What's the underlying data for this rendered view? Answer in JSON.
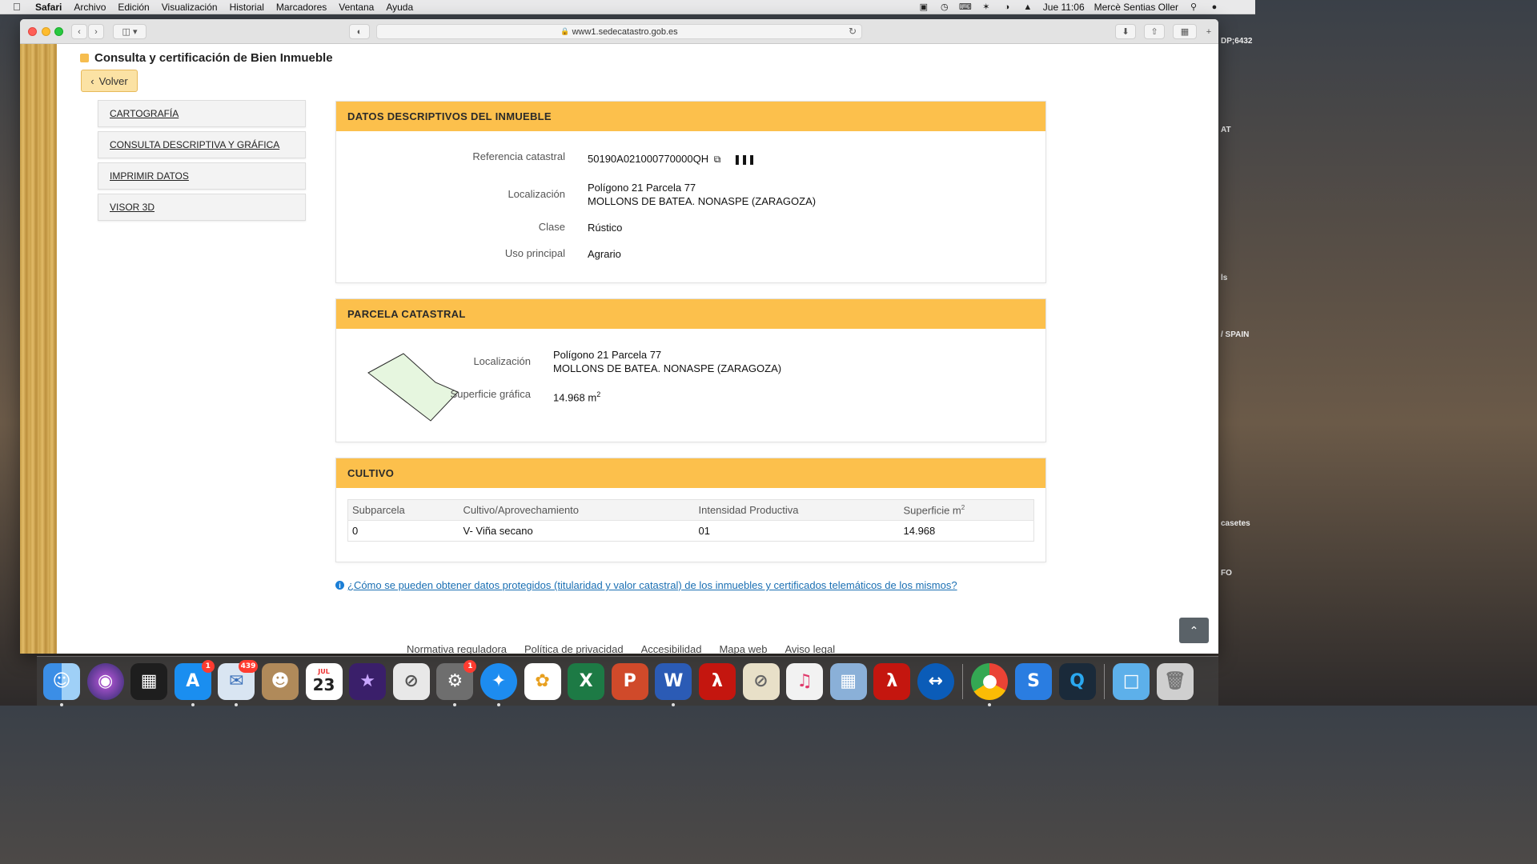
{
  "menubar": {
    "app": "Safari",
    "items": [
      "Archivo",
      "Edición",
      "Visualización",
      "Historial",
      "Marcadores",
      "Ventana",
      "Ayuda"
    ],
    "clock": "Jue 11:06",
    "user": "Mercè Sentias Oller"
  },
  "desktop_fragments": [
    "DP;6432",
    "AT",
    "ls",
    "/ SPAIN",
    "casetes",
    "FO"
  ],
  "browser": {
    "url": "www1.sedecatastro.gob.es"
  },
  "page": {
    "title": "Consulta y certificación de Bien Inmueble",
    "back_label": "Volver",
    "nav": [
      "CARTOGRAFÍA",
      "CONSULTA DESCRIPTIVA Y GRÁFICA",
      "IMPRIMIR DATOS",
      "VISOR 3D"
    ],
    "datos": {
      "heading": "DATOS DESCRIPTIVOS DEL INMUEBLE",
      "ref_label": "Referencia catastral",
      "ref_value": "50190A021000770000QH",
      "loc_label": "Localización",
      "loc_line1": "Polígono 21 Parcela 77",
      "loc_line2": "MOLLONS DE BATEA. NONASPE (ZARAGOZA)",
      "clase_label": "Clase",
      "clase_value": "Rústico",
      "uso_label": "Uso principal",
      "uso_value": "Agrario"
    },
    "parcela": {
      "heading": "PARCELA CATASTRAL",
      "loc_label": "Localización",
      "loc_line1": "Polígono 21 Parcela 77",
      "loc_line2": "MOLLONS DE BATEA. NONASPE (ZARAGOZA)",
      "sup_label": "Superficie gráfica",
      "sup_value": "14.968 m",
      "sup_exp": "2"
    },
    "cultivo": {
      "heading": "CULTIVO",
      "columns": [
        "Subparcela",
        "Cultivo/Aprovechamiento",
        "Intensidad Productiva",
        "Superficie m"
      ],
      "col_exp": "2",
      "rows": [
        [
          "0",
          "V- Viña secano",
          "01",
          "14.968"
        ]
      ]
    },
    "info_link": "¿Cómo se pueden obtener datos protegidos (titularidad y valor catastral) de los inmuebles y certificados telemáticos de los mismos?",
    "footer": [
      "Normativa reguladora",
      "Política de privacidad",
      "Accesibilidad",
      "Mapa web",
      "Aviso legal"
    ]
  },
  "dock": {
    "badges": {
      "appstore": "1",
      "mail": "439",
      "sysprefs": "1"
    },
    "calendar_month": "JUL",
    "calendar_day": "23"
  }
}
